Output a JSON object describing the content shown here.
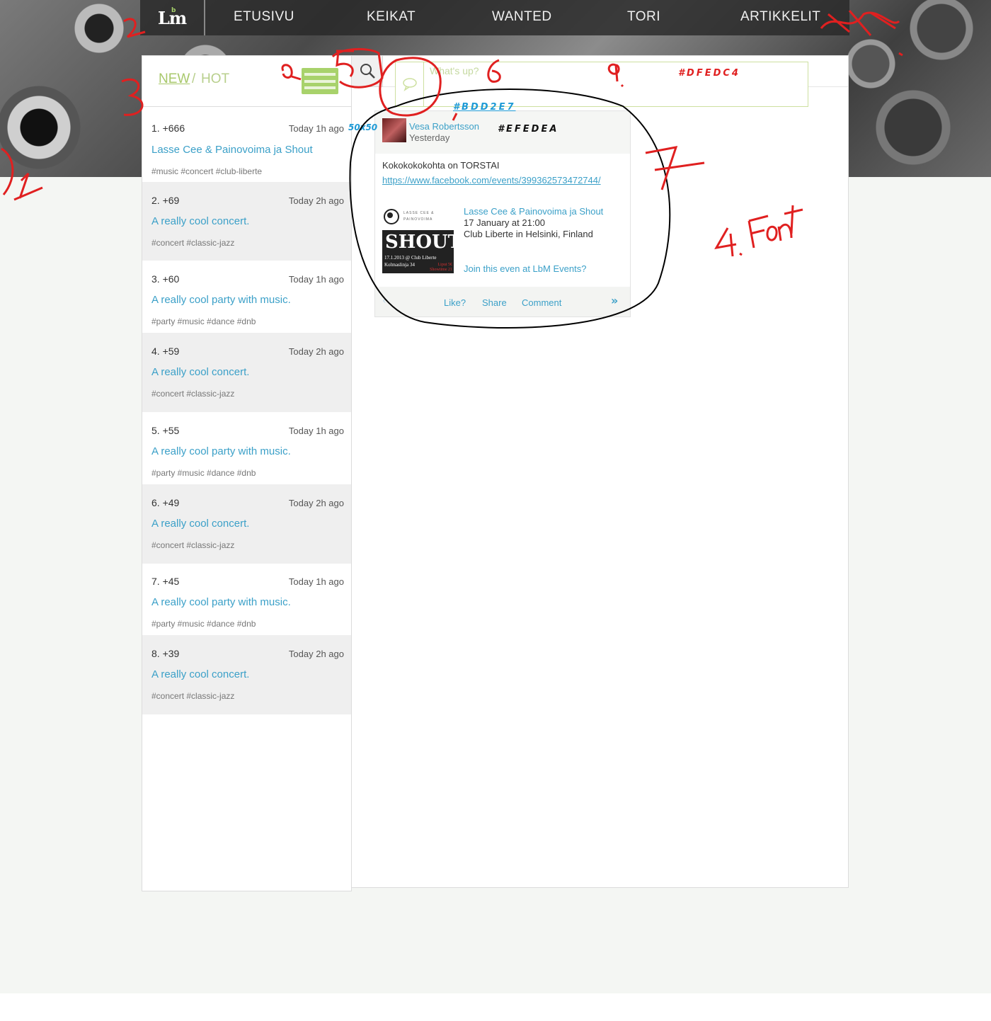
{
  "nav": {
    "logo": "Lm",
    "logo_sup": "b",
    "items": [
      "ETUSIVU",
      "KEIKAT",
      "WANTED",
      "TORI",
      "ARTIKKELIT"
    ]
  },
  "tabs": {
    "new": "NEW",
    "separator": "/",
    "hot": "HOT"
  },
  "feed": [
    {
      "rank": "1. +666",
      "time": "Today 1h ago",
      "title": "Lasse Cee & Painovoima ja Shout",
      "tags": "#music #concert #club-liberte"
    },
    {
      "rank": "2. +69",
      "time": "Today 2h ago",
      "title": "A really cool concert.",
      "tags": "#concert #classic-jazz"
    },
    {
      "rank": "3. +60",
      "time": "Today 1h ago",
      "title": "A really cool party with music.",
      "tags": "#party #music #dance #dnb"
    },
    {
      "rank": "4. +59",
      "time": "Today 2h ago",
      "title": "A really cool concert.",
      "tags": "#concert #classic-jazz"
    },
    {
      "rank": "5. +55",
      "time": "Today 1h ago",
      "title": "A really cool party with music.",
      "tags": "#party #music #dance #dnb"
    },
    {
      "rank": "6. +49",
      "time": "Today 2h ago",
      "title": "A really cool concert.",
      "tags": "#concert #classic-jazz"
    },
    {
      "rank": "7. +45",
      "time": "Today 1h ago",
      "title": "A really cool party with music.",
      "tags": "#party #music #dance #dnb"
    },
    {
      "rank": "8. +39",
      "time": "Today 2h ago",
      "title": "A really cool concert.",
      "tags": "#concert #classic-jazz"
    }
  ],
  "compose": {
    "placeholder": "What's up?"
  },
  "post": {
    "author": "Vesa Robertsson",
    "date": "Yesterday",
    "text": "Kokokokokohta on TORSTAI",
    "link": "https://www.facebook.com/events/399362573472744/",
    "event": {
      "title": "Lasse Cee & Painovoima ja Shout",
      "date": "17 January at 21:00",
      "place": "Club Liberte in Helsinki, Finland",
      "join": "Join this even at LbM Events?",
      "image": {
        "logo_line1": "LASSE CEE &",
        "logo_line2": "PAINOVOIMA",
        "headline": "SHOUT",
        "line1": "17.1.2013 @ Club Liberte",
        "line2": "Kolmaslinja 34",
        "red1": "Liput 5€",
        "red2": "Showtime 21"
      }
    },
    "actions": {
      "like": "Like?",
      "share": "Share",
      "comment": "Comment",
      "next": "»",
      "prev": "‹"
    }
  },
  "annotations": {
    "color_compose": "#DFEDC4",
    "color_blue": "#BDD2E7",
    "color_card": "#EFEDEA",
    "avatar_size": "50x50",
    "numbers": [
      "1",
      "2",
      "3",
      "4. Font",
      "5",
      "6",
      "7",
      "7.",
      "9"
    ]
  },
  "colors": {
    "accent_green": "#a8d26b",
    "link_blue": "#3ba0c8",
    "annotation_red": "#e02020",
    "annotation_blue": "#1f9bd6"
  }
}
